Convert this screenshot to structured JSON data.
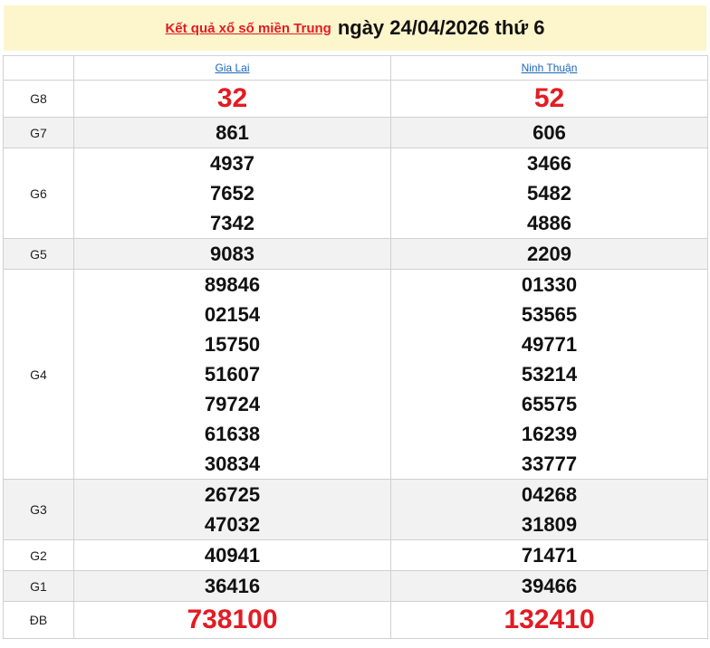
{
  "header": {
    "link_text": "Kết quả xổ số miền Trung",
    "date_text": "ngày 24/04/2026 thứ 6"
  },
  "columns": [
    "Gia Lai",
    "Ninh Thuận"
  ],
  "colors": {
    "accent_red": "#e31b23",
    "link_blue": "#1b66b8",
    "header_bg": "#fdf6cc",
    "alt_row_bg": "#f2f2f2"
  },
  "rows": [
    {
      "label": "G8",
      "values": [
        [
          "32"
        ],
        [
          "52"
        ]
      ]
    },
    {
      "label": "G7",
      "values": [
        [
          "861"
        ],
        [
          "606"
        ]
      ]
    },
    {
      "label": "G6",
      "values": [
        [
          "4937",
          "7652",
          "7342"
        ],
        [
          "3466",
          "5482",
          "4886"
        ]
      ]
    },
    {
      "label": "G5",
      "values": [
        [
          "9083"
        ],
        [
          "2209"
        ]
      ]
    },
    {
      "label": "G4",
      "values": [
        [
          "89846",
          "02154",
          "15750",
          "51607",
          "79724",
          "61638",
          "30834"
        ],
        [
          "01330",
          "53565",
          "49771",
          "53214",
          "65575",
          "16239",
          "33777"
        ]
      ]
    },
    {
      "label": "G3",
      "values": [
        [
          "26725",
          "47032"
        ],
        [
          "04268",
          "31809"
        ]
      ]
    },
    {
      "label": "G2",
      "values": [
        [
          "40941"
        ],
        [
          "71471"
        ]
      ]
    },
    {
      "label": "G1",
      "values": [
        [
          "36416"
        ],
        [
          "39466"
        ]
      ]
    },
    {
      "label": "ĐB",
      "values": [
        [
          "738100"
        ],
        [
          "132410"
        ]
      ]
    }
  ]
}
